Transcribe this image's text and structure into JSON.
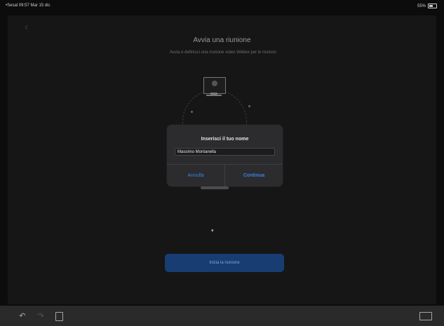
{
  "status_bar": {
    "left": "•Sesal 09:57 Mar 15 dic",
    "right": "55%"
  },
  "screen": {
    "title": "Avvia una riunione",
    "subtitle": "Avvia e definisci una riunione video Webex per le riunioni."
  },
  "dialog": {
    "title": "Inserisci il tuo nome",
    "input_value": "Massimo Montanella",
    "cancel_label": "Annulla",
    "continue_label": "Continua"
  },
  "start_button": {
    "label": "Inizia la riunione"
  },
  "icons": {
    "undo": "undo-icon",
    "redo": "redo-icon",
    "clipboard": "clipboard-icon",
    "keyboard": "keyboard-icon"
  }
}
